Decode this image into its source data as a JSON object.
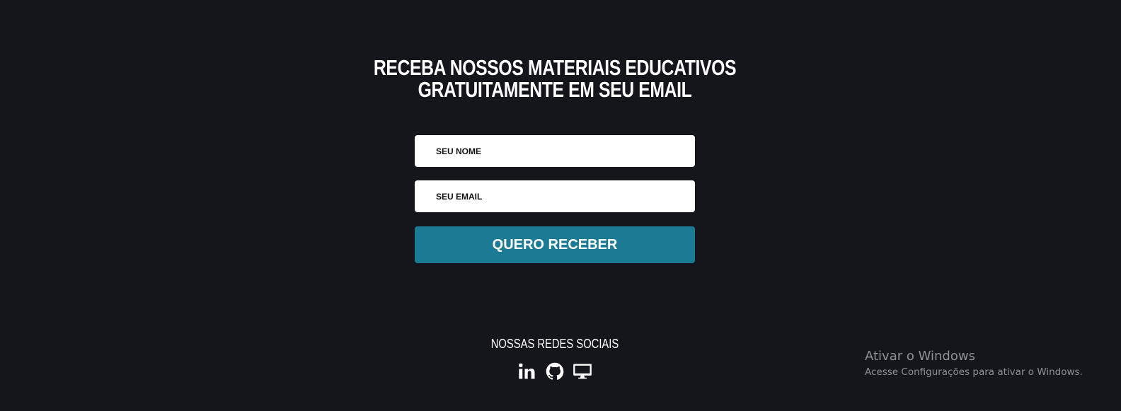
{
  "signup": {
    "headline_line1": "RECEBA NOSSOS MATERIAIS EDUCATIVOS",
    "headline_line2": "GRATUITAMENTE EM SEU EMAIL",
    "name_placeholder": "SEU NOME",
    "name_value": "",
    "email_placeholder": "SEU EMAIL",
    "email_value": "",
    "submit_label": "QUERO RECEBER"
  },
  "social": {
    "title": "NOSSAS REDES SOCIAIS",
    "icons": [
      "linkedin-icon",
      "github-icon",
      "desktop-icon"
    ]
  },
  "watermark": {
    "title": "Ativar o Windows",
    "subtitle": "Acesse Configurações para ativar o Windows."
  },
  "colors": {
    "background": "#15161b",
    "accent": "#1b7a94",
    "text": "#ffffff"
  }
}
